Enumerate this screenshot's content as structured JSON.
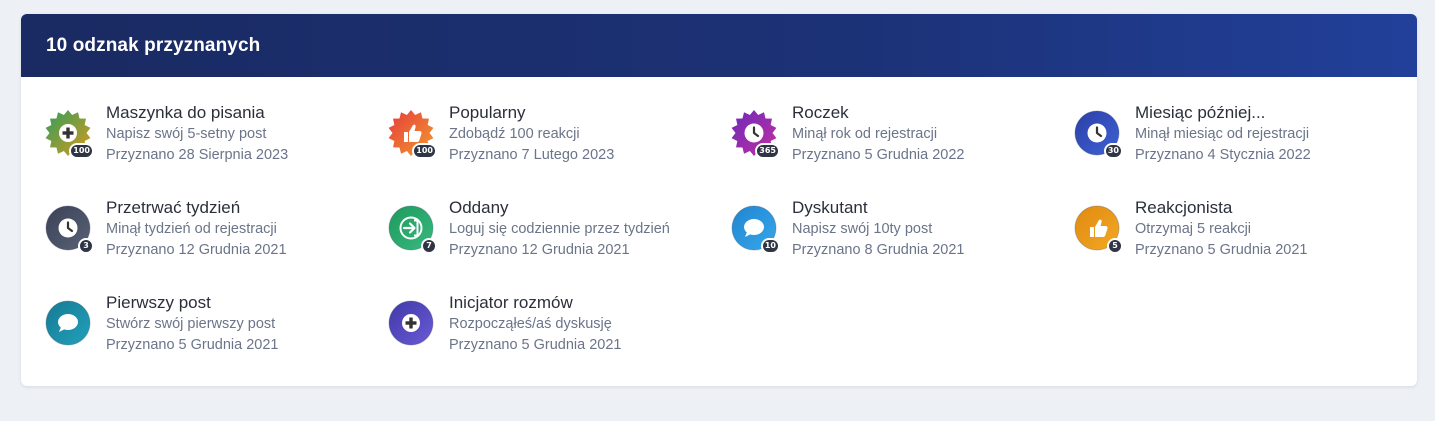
{
  "header": {
    "title": "10 odznak przyznanych"
  },
  "badges": [
    {
      "title": "Maszynka do pisania",
      "desc": "Napisz swój 5-setny post",
      "date": "Przyznano 28 Sierpnia 2023",
      "count": "100",
      "icon": "plus-icon",
      "shape": "star",
      "colors": [
        "#2f9e5b",
        "#d99a1e"
      ]
    },
    {
      "title": "Popularny",
      "desc": "Zdobądź 100 reakcji",
      "date": "Przyznano 7 Lutego 2023",
      "count": "100",
      "icon": "thumbs-up-icon",
      "shape": "star",
      "colors": [
        "#e63c3c",
        "#f29a2e"
      ]
    },
    {
      "title": "Roczek",
      "desc": "Minął rok od rejestracji",
      "date": "Przyznano 5 Grudnia 2022",
      "count": "365",
      "icon": "clock-icon",
      "shape": "star",
      "colors": [
        "#6d2ab8",
        "#c12fa4"
      ]
    },
    {
      "title": "Miesiąc później...",
      "desc": "Minął miesiąc od rejestracji",
      "date": "Przyznano 4 Stycznia 2022",
      "count": "30",
      "icon": "clock-icon",
      "shape": "circle",
      "colors": [
        "#2b3fa6",
        "#3e62d6"
      ]
    },
    {
      "title": "Przetrwać tydzień",
      "desc": "Minął tydzień od rejestracji",
      "date": "Przyznano 12 Grudnia 2021",
      "count": "3",
      "icon": "clock-icon",
      "shape": "circle",
      "colors": [
        "#3b4256",
        "#596178"
      ]
    },
    {
      "title": "Oddany",
      "desc": "Loguj się codziennie przez tydzień",
      "date": "Przyznano 12 Grudnia 2021",
      "count": "7",
      "icon": "login-arrow-icon",
      "shape": "circle",
      "colors": [
        "#1f9a5c",
        "#37b980"
      ]
    },
    {
      "title": "Dyskutant",
      "desc": "Napisz swój 10ty post",
      "date": "Przyznano 8 Grudnia 2021",
      "count": "10",
      "icon": "chat-bubble-icon",
      "shape": "circle",
      "colors": [
        "#1f86d1",
        "#38a6ea"
      ]
    },
    {
      "title": "Reakcjonista",
      "desc": "Otrzymaj 5 reakcji",
      "date": "Przyznano 5 Grudnia 2021",
      "count": "5",
      "icon": "thumbs-up-icon",
      "shape": "circle",
      "colors": [
        "#e08a10",
        "#f3a825"
      ]
    },
    {
      "title": "Pierwszy post",
      "desc": "Stwórz swój pierwszy post",
      "date": "Przyznano 5 Grudnia 2021",
      "count": "",
      "icon": "chat-bubble-icon",
      "shape": "circle",
      "colors": [
        "#157a94",
        "#23a0bc"
      ]
    },
    {
      "title": "Inicjator rozmów",
      "desc": "Rozpocząłeś/aś dyskusję",
      "date": "Przyznano 5 Grudnia 2021",
      "count": "",
      "icon": "plus-icon",
      "shape": "circle",
      "colors": [
        "#4039a8",
        "#6a5ad6"
      ]
    }
  ]
}
